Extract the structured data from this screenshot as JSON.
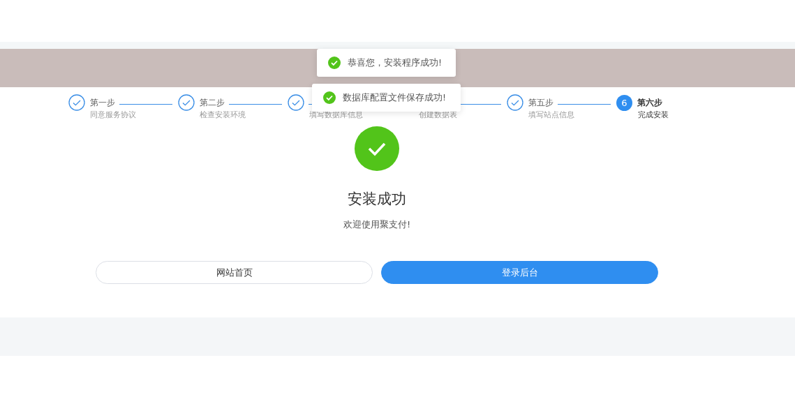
{
  "steps": [
    {
      "title": "第一步",
      "description": "同意服务协议",
      "completed": true
    },
    {
      "title": "第二步",
      "description": "检查安装环境",
      "completed": true
    },
    {
      "description": "填写数据库信息",
      "completed": true
    },
    {
      "description": "创建数据表"
    },
    {
      "title": "第五步",
      "description": "填写站点信息",
      "completed": true
    },
    {
      "title": "第六步",
      "description": "完成安装",
      "completed": false,
      "number": "6"
    }
  ],
  "result": {
    "title": "安装成功",
    "message": "欢迎使用聚支付!"
  },
  "buttons": [
    {
      "label": "网站首页",
      "kind": "secondary"
    },
    {
      "label": "登录后台",
      "kind": "primary"
    }
  ],
  "toasts": [
    "恭喜您，安装程序成功!",
    "数据库配置文件保存成功!"
  ]
}
